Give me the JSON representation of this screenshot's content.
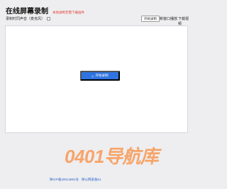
{
  "header": {
    "title": "在线屏幕录制",
    "subtitle": "本地录制无需下载插件"
  },
  "toolbar": {
    "record_mic_label": "录制时同声音（麦克风）",
    "start_small_label": "开始录制",
    "link_new_window": "新窗口播放",
    "link_download": "下载视频"
  },
  "stage": {
    "play_glyph": "▷",
    "start_button_label": "开始录制"
  },
  "watermark": "0401导航库",
  "footer": {
    "icp": "陕ICP备20014891号",
    "police": "陕公网安备61"
  },
  "colors": {
    "accent": "#2f73e0",
    "subtitle": "#e53935",
    "watermark": "#ff6a00"
  }
}
